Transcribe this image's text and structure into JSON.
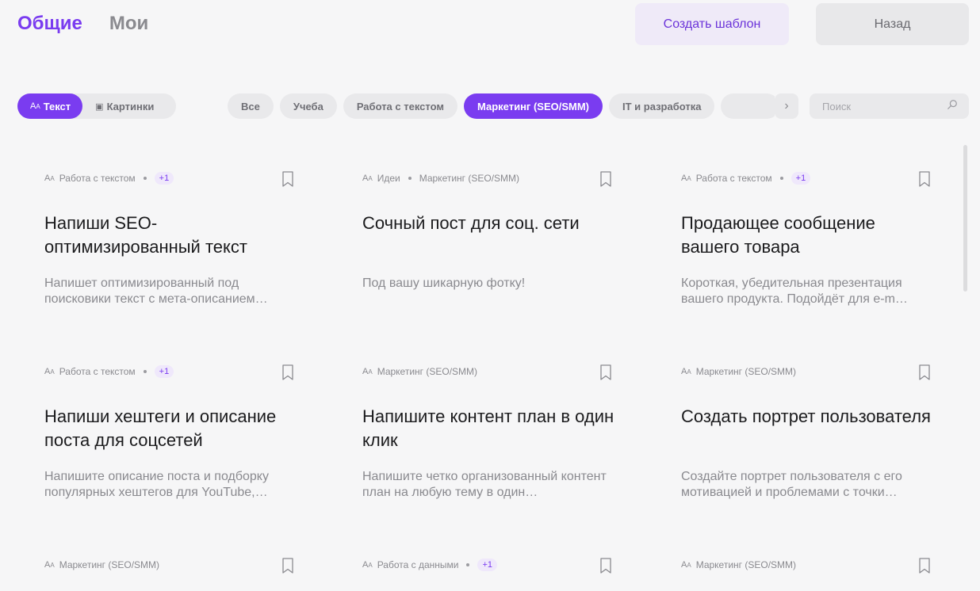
{
  "header": {
    "tabs": [
      {
        "label": "Общие",
        "active": true
      },
      {
        "label": "Мои",
        "active": false
      }
    ],
    "create_button": "Создать шаблон",
    "back_button": "Назад"
  },
  "type_toggle": {
    "options": [
      {
        "icon": "text-icon",
        "glyph": "A",
        "label": "Текст",
        "active": true
      },
      {
        "icon": "image-icon",
        "glyph": "▣",
        "label": "Картинки",
        "active": false
      }
    ]
  },
  "categories": [
    {
      "label": "Все",
      "active": false
    },
    {
      "label": "Учеба",
      "active": false
    },
    {
      "label": "Работа с текстом",
      "active": false
    },
    {
      "label": "Маркетинг (SEO/SMM)",
      "active": true
    },
    {
      "label": "IT и разработка",
      "active": false
    },
    {
      "label": "",
      "active": false
    }
  ],
  "search": {
    "placeholder": "Поиск"
  },
  "colors": {
    "accent": "#7a3cf0",
    "accent_light": "#efeaf8",
    "background": "#f6f6f7",
    "chip": "#e9e9eb"
  },
  "cards": [
    {
      "category": "Работа с текстом",
      "secondary": "",
      "badge": "+1",
      "title": "Напиши SEO-оптимизированный текст",
      "description": "Напишет оптимизированный под поисковики текст с мета-описанием…"
    },
    {
      "category": "Идеи",
      "secondary": "Маркетинг (SEO/SMM)",
      "badge": "",
      "title": "Сочный пост для соц. сети",
      "description": "Под вашу шикарную фотку!"
    },
    {
      "category": "Работа с текстом",
      "secondary": "",
      "badge": "+1",
      "title": "Продающее сообщение вашего товара",
      "description": "Короткая, убедительная презентация вашего продукта. Подойдёт для e-m…"
    },
    {
      "category": "Работа с текстом",
      "secondary": "",
      "badge": "+1",
      "title": "Напиши хештеги и описание поста для соцсетей",
      "description": "Напишите описание поста и подборку популярных хештегов для YouTube,…"
    },
    {
      "category": "Маркетинг (SEO/SMM)",
      "secondary": "",
      "badge": "",
      "title": "Напишите контент план в один клик",
      "description": "Напишите четко организованный контент план на любую тему в один…"
    },
    {
      "category": "Маркетинг (SEO/SMM)",
      "secondary": "",
      "badge": "",
      "title": "Создать портрет пользователя",
      "description": "Создайте портрет пользователя с его мотивацией и проблемами с точки…"
    },
    {
      "category": "Маркетинг (SEO/SMM)",
      "secondary": "",
      "badge": "",
      "title": "",
      "description": ""
    },
    {
      "category": "Работа с данными",
      "secondary": "",
      "badge": "+1",
      "title": "",
      "description": ""
    },
    {
      "category": "Маркетинг (SEO/SMM)",
      "secondary": "",
      "badge": "",
      "title": "",
      "description": ""
    }
  ]
}
